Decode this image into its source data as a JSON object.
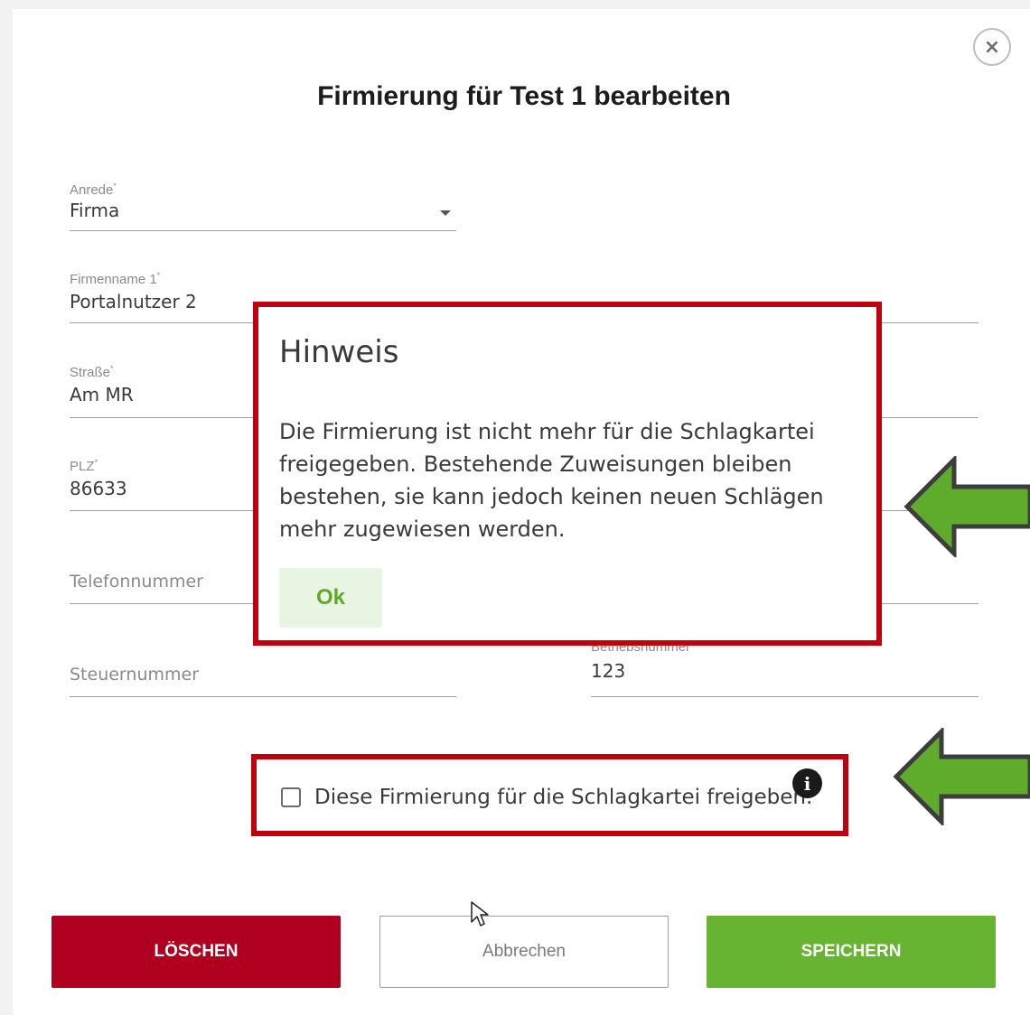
{
  "dialog": {
    "title": "Firmierung für Test 1 bearbeiten",
    "close_label": "×"
  },
  "form": {
    "anrede": {
      "label": "Anrede",
      "required_mark": "*",
      "value": "Firma"
    },
    "firmenname1": {
      "label": "Firmenname 1",
      "required_mark": "*",
      "value": "Portalnutzer 2"
    },
    "strasse": {
      "label": "Straße",
      "required_mark": "*",
      "value": "Am MR"
    },
    "plz": {
      "label": "PLZ",
      "required_mark": "*",
      "value": "86633"
    },
    "telefon": {
      "placeholder": "Telefonnummer"
    },
    "steuernummer": {
      "placeholder": "Steuernummer"
    },
    "betriebsnummer": {
      "label": "Betriebsnummer",
      "value": "123"
    }
  },
  "popup": {
    "title": "Hinweis",
    "body": "Die Firmierung ist nicht mehr für die Schlagkartei freigegeben. Bestehende Zuweisungen bleiben bestehen, sie kann jedoch keinen neuen Schlägen mehr zugewiesen werden.",
    "ok_label": "Ok"
  },
  "release_checkbox": {
    "label": "Diese Firmierung für die Schlagkartei freigeben.",
    "checked": false,
    "info_icon": "i"
  },
  "buttons": {
    "delete": "LÖSCHEN",
    "cancel": "Abbrechen",
    "save": "SPEICHERN"
  },
  "colors": {
    "highlight_red": "#c0000e",
    "delete_red": "#b00020",
    "save_green": "#66b42f",
    "arrow_green": "#5fab2c"
  }
}
